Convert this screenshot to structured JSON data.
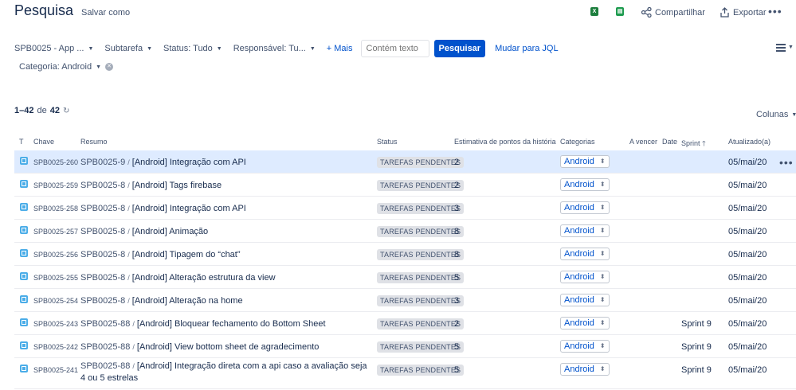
{
  "header": {
    "title": "Pesquisa",
    "save_as": "Salvar como",
    "share": "Compartilhar",
    "export": "Exportar",
    "excel_glyph": "X",
    "sheet_glyph": "▤"
  },
  "filters": {
    "project": "SPB0025 - App ...",
    "type": "Subtarefa",
    "status": "Status: Tudo",
    "assignee": "Responsável: Tu...",
    "more": "+ Mais",
    "search_placeholder": "Contém texto",
    "search_button": "Pesquisar",
    "jql_link": "Mudar para JQL",
    "category": "Categoria: Android"
  },
  "results": {
    "range": "1–42",
    "of": "de",
    "total": "42",
    "columns_button": "Colunas"
  },
  "columns": {
    "type": "T",
    "key": "Chave",
    "summary": "Resumo",
    "status": "Status",
    "points": "Estimativa de pontos da história",
    "categories": "Categorias",
    "due": "A vencer",
    "date": "Date",
    "sprint": "Sprint",
    "updated": "Atualizado(a)"
  },
  "rows": [
    {
      "key": "SPB0025-260",
      "parent": "SPB0025-9",
      "summary": "[Android] Integração com API",
      "status": "TAREFAS PENDENTES",
      "points": "2",
      "category": "Android",
      "sprint": "",
      "updated": "05/mai/20"
    },
    {
      "key": "SPB0025-259",
      "parent": "SPB0025-8",
      "summary": "[Android] Tags firebase",
      "status": "TAREFAS PENDENTES",
      "points": "2",
      "category": "Android",
      "sprint": "",
      "updated": "05/mai/20"
    },
    {
      "key": "SPB0025-258",
      "parent": "SPB0025-8",
      "summary": "[Android] Integração com API",
      "status": "TAREFAS PENDENTES",
      "points": "3",
      "category": "Android",
      "sprint": "",
      "updated": "05/mai/20"
    },
    {
      "key": "SPB0025-257",
      "parent": "SPB0025-8",
      "summary": "[Android] Animação",
      "status": "TAREFAS PENDENTES",
      "points": "8",
      "category": "Android",
      "sprint": "",
      "updated": "05/mai/20"
    },
    {
      "key": "SPB0025-256",
      "parent": "SPB0025-8",
      "summary": "[Android] Tipagem do “chat”",
      "status": "TAREFAS PENDENTES",
      "points": "8",
      "category": "Android",
      "sprint": "",
      "updated": "05/mai/20"
    },
    {
      "key": "SPB0025-255",
      "parent": "SPB0025-8",
      "summary": "[Android] Alteração estrutura da view",
      "status": "TAREFAS PENDENTES",
      "points": "5",
      "category": "Android",
      "sprint": "",
      "updated": "05/mai/20"
    },
    {
      "key": "SPB0025-254",
      "parent": "SPB0025-8",
      "summary": "[Android] Alteração na home",
      "status": "TAREFAS PENDENTES",
      "points": "3",
      "category": "Android",
      "sprint": "",
      "updated": "05/mai/20"
    },
    {
      "key": "SPB0025-243",
      "parent": "SPB0025-88",
      "summary": "[Android] Bloquear fechamento do Bottom Sheet",
      "status": "TAREFAS PENDENTES",
      "points": "2",
      "category": "Android",
      "sprint": "Sprint 9",
      "updated": "05/mai/20"
    },
    {
      "key": "SPB0025-242",
      "parent": "SPB0025-88",
      "summary": "[Android] View bottom sheet de agradecimento",
      "status": "TAREFAS PENDENTES",
      "points": "5",
      "category": "Android",
      "sprint": "Sprint 9",
      "updated": "05/mai/20"
    },
    {
      "key": "SPB0025-241",
      "parent": "SPB0025-88",
      "summary": "[Android] Integração direta com a api caso a avaliação seja 4 ou 5 estrelas",
      "status": "TAREFAS PENDENTES",
      "points": "5",
      "category": "Android",
      "sprint": "Sprint 9",
      "updated": "05/mai/20"
    }
  ],
  "colors": {
    "accent": "#0052cc",
    "row_highlight": "#deebff",
    "issue_icon": "#4bade8"
  }
}
